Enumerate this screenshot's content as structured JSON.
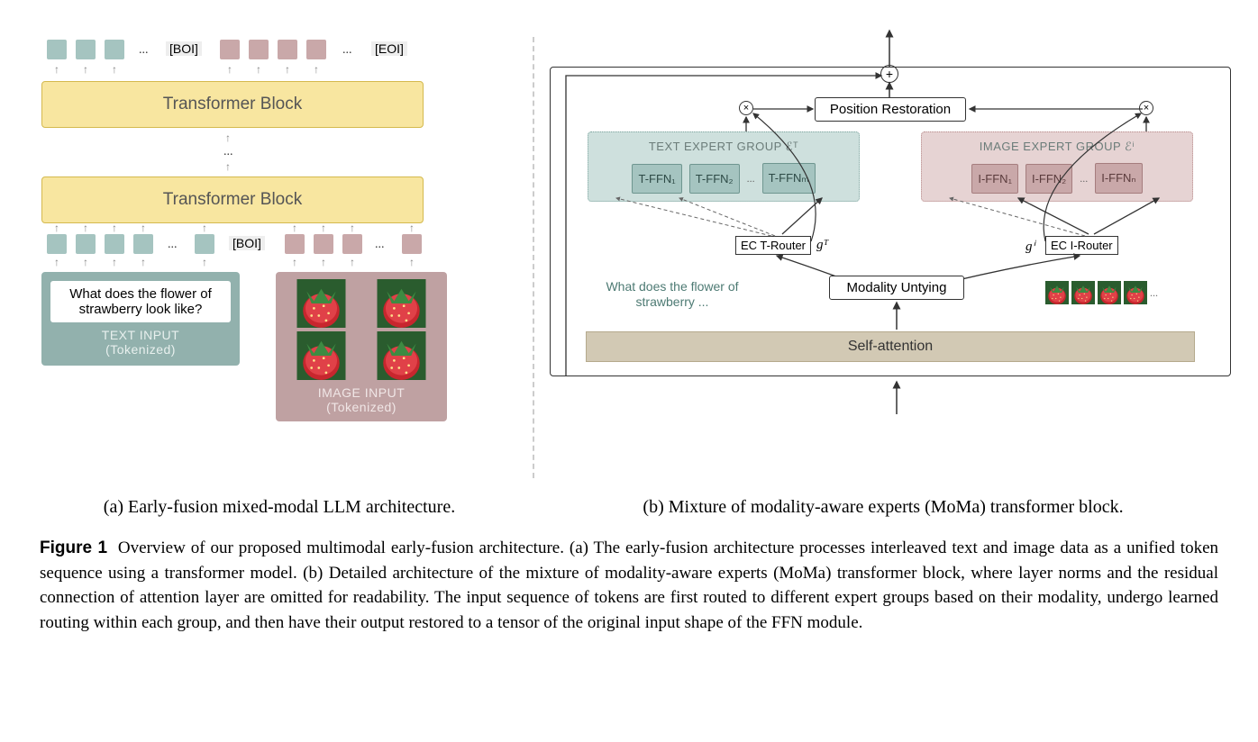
{
  "colors": {
    "teal": "#a5c4c0",
    "pink": "#c9a8a9",
    "yellow": "#f8e6a0",
    "text_group": "#cee0dd",
    "image_group": "#e6d3d3"
  },
  "left": {
    "transformer_block": "Transformer Block",
    "boi": "[BOI]",
    "eoi": "[EOI]",
    "text_input": {
      "prompt": "What does the flower of strawberry look like?",
      "title": "TEXT INPUT",
      "subtitle": "(Tokenized)"
    },
    "image_input": {
      "title": "IMAGE INPUT",
      "subtitle": "(Tokenized)"
    },
    "dots": "..."
  },
  "right": {
    "position_restoration": "Position Restoration",
    "text_expert_title": "TEXT EXPERT GROUP  ℰᵀ",
    "image_expert_title": "IMAGE EXPERT GROUP  ℰⁱ",
    "t_ffn_1": "T-FFN₁",
    "t_ffn_2": "T-FFN₂",
    "t_ffn_m": "T-FFNₘ",
    "i_ffn_1": "I-FFN₁",
    "i_ffn_2": "I-FFN₂",
    "i_ffn_n": "I-FFNₙ",
    "ec_t_router": "EC T-Router",
    "ec_i_router": "EC I-Router",
    "g_t": "gᵀ",
    "g_i": "gⁱ",
    "modality_untying": "Modality Untying",
    "self_attention": "Self-attention",
    "conn_text": "What does the flower of strawberry ...",
    "dots": "..."
  },
  "captions": {
    "left": "(a) Early-fusion mixed-modal LLM architecture.",
    "right": "(b) Mixture of modality-aware experts (MoMa) transformer block."
  },
  "figure_label": "Figure 1",
  "figure_text": "Overview of our proposed multimodal early-fusion architecture. (a) The early-fusion architecture processes interleaved text and image data as a unified token sequence using a transformer model. (b) Detailed architecture of the mixture of modality-aware experts (MoMa) transformer block, where layer norms and the residual connection of attention layer are omitted for readability. The input sequence of tokens are first routed to different expert groups based on their modality, undergo learned routing within each group, and then have their output restored to a tensor of the original input shape of the FFN module."
}
